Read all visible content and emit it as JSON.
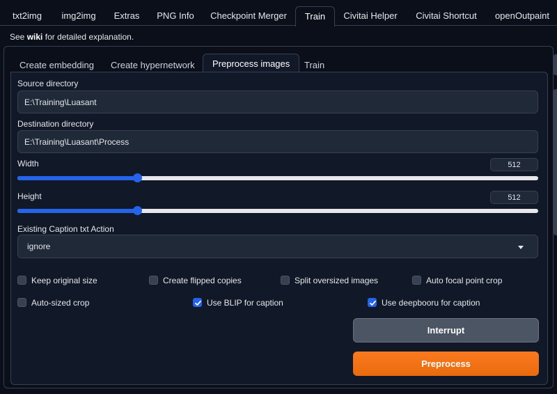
{
  "top_tabs": [
    "txt2img",
    "img2img",
    "Extras",
    "PNG Info",
    "Checkpoint Merger",
    "Train",
    "Civitai Helper",
    "Civitai Shortcut",
    "openOutpaint"
  ],
  "active_top_tab": "Train",
  "wiki": {
    "prefix": "See",
    "link": "wiki",
    "suffix": "for detailed explanation."
  },
  "sub_tabs": [
    "Create embedding",
    "Create hypernetwork",
    "Preprocess images",
    "Train"
  ],
  "active_sub_tab": "Preprocess images",
  "source": {
    "label": "Source directory",
    "value": "E:\\Training\\Luasant"
  },
  "destination": {
    "label": "Destination directory",
    "value": "E:\\Training\\Luasant\\Process"
  },
  "width": {
    "label": "Width",
    "value": "512",
    "fraction": 0.23
  },
  "height": {
    "label": "Height",
    "value": "512",
    "fraction": 0.23
  },
  "caption_action": {
    "label": "Existing Caption txt Action",
    "value": "ignore"
  },
  "checkboxes": {
    "keep_original_size": {
      "label": "Keep original size",
      "checked": false
    },
    "create_flipped_copies": {
      "label": "Create flipped copies",
      "checked": false
    },
    "split_oversized": {
      "label": "Split oversized images",
      "checked": false
    },
    "auto_focal_point": {
      "label": "Auto focal point crop",
      "checked": false
    },
    "auto_sized_crop": {
      "label": "Auto-sized crop",
      "checked": false
    },
    "use_blip": {
      "label": "Use BLIP for caption",
      "checked": true
    },
    "use_deepbooru": {
      "label": "Use deepbooru for caption",
      "checked": true
    }
  },
  "buttons": {
    "interrupt": "Interrupt",
    "preprocess": "Preprocess"
  }
}
